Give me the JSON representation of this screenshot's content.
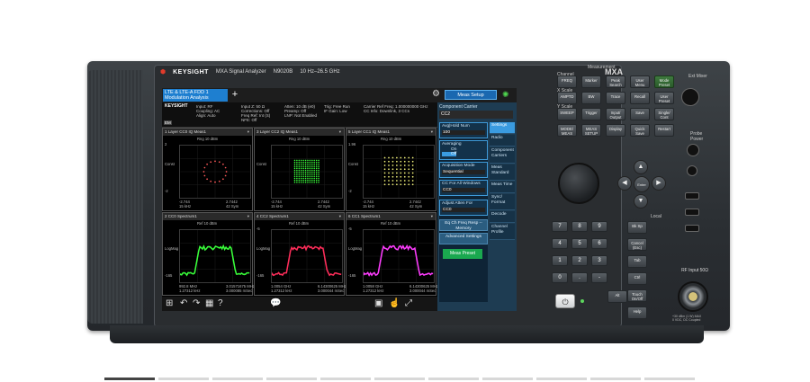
{
  "brand": {
    "logo_mark": "⬢",
    "name": "KEYSIGHT",
    "model": "MXA Signal Analyzer",
    "model_no": "N9020B",
    "range": "10 Hz–26.5 GHz",
    "badge": "MXA"
  },
  "screen": {
    "active_tab": "LTE & LTE-A FDD 1\nModulation Analysis",
    "add_tab": "+",
    "meas_setup": "Meas Setup",
    "info": {
      "keysight": "KEYSIGHT",
      "col1": "Input: RF\nCoupling: AC\nAlign: Auto",
      "col2": "Input Z: 50 Ω\nCorrections: Off\nFreq Ref: Int (S)\nNFE: Off",
      "col3": "Atten: 10 dB (e0)\nPreamp: Off\nLNP: Not Enabled",
      "col4": "Trig: Free Run\nIF Gain: Low",
      "col5": "Carrier Ref Freq: 1.000000000 GHz\nCC Info: Downlink, 3 CCs",
      "badge": "EM"
    },
    "windows": [
      {
        "title": "1 Layer CC0 IQ Meas1",
        "scale": "Rng 10 dBm",
        "ylabel": "Const",
        "ytop": "2",
        "ybot": "-2",
        "xleft": "-2.744\n15 kHz",
        "xright": "2.7442\n42 Sym",
        "kind": "const-ring"
      },
      {
        "title": "3 Layer CC2 IQ Meas1",
        "scale": "Rng 10 dBm",
        "ylabel": "Const",
        "ytop": "",
        "ybot": "",
        "xleft": "-2.744\n15 kHz",
        "xright": "2.7442\n42 Sym",
        "kind": "const-dense"
      },
      {
        "title": "5 Layer CC1 IQ Meas1",
        "scale": "Rng 10 dBm",
        "ylabel": "Const",
        "ytop": "1.96",
        "ybot": "-2",
        "xleft": "-2.744\n15 kHz",
        "xright": "2.7442\n42 Sym",
        "kind": "const-grid"
      },
      {
        "title": "2 CC0 Spectrum1",
        "scale": "Ref 10 dBm",
        "ylabel": "LogMag",
        "ytop": "",
        "ybot": "-165",
        "xleft": "992.8 MHz\n1.27312 kHz",
        "xright": "3.01571675 MHz\n3.000085 mSec",
        "kind": "spec-green"
      },
      {
        "title": "4 CC2 Spectrum1",
        "scale": "Ref 10 dBm",
        "ylabel": "LogMag",
        "ytop": "-5",
        "ybot": "-165",
        "xleft": "1.0054 GHz\n1.27312 kHz",
        "xright": "6.14300625 MHz\n3.000044 mSec",
        "kind": "spec-red"
      },
      {
        "title": "6 CC1 Spectrum1",
        "scale": "Ref 10 dBm",
        "ylabel": "LogMag",
        "ytop": "-5",
        "ybot": "-165",
        "xleft": "1.0058 GHz\n1.27312 kHz",
        "xright": "6.14300625 MHz\n3.000044 mSec",
        "kind": "spec-magenta"
      }
    ],
    "side": {
      "component_carrier_label": "Component Carrier",
      "component_carrier_value": "CC2",
      "avg_hold_label": "Avg|Hold Num",
      "avg_hold_value": "100",
      "averaging_label": "Averaging",
      "averaging_on": "On",
      "averaging_off": "Off",
      "acq_label": "Acquisition Mode",
      "acq_value": "Sequential",
      "cc_all_label": "CC For All Windows",
      "cc_all_value": "CC0",
      "adjust_label": "Adjust Atten For",
      "adjust_value": "CC0",
      "eq_btn": "Eq Ch Freq Resp --\nMemory",
      "adv_btn": "Advanced\nSettings",
      "meas_preset": "Meas Preset",
      "tabs": [
        "Settings",
        "Radio",
        "Component\nCarriers",
        "Meas\nStandard",
        "Meas Time",
        "Sync/\nFormat",
        "Decode",
        "Channel\nProfile"
      ]
    },
    "taskbar": [
      "⊞",
      "↶",
      "↷",
      "▦",
      "?",
      "💬",
      "▣",
      "☝",
      "⤢"
    ]
  },
  "panel": {
    "hdr_channel": "Channel",
    "hdr_measurement": "Measurement",
    "hdr_xscale": "X Scale",
    "hdr_yscale": "Y Scale",
    "hdr_local": "Local",
    "hdr_windows": "Windows",
    "keys": [
      "FREQ",
      "Marker",
      "Peak\nSearch",
      "User\nMenu",
      "Mode\nPreset",
      "AMPTD",
      "BW",
      "Trace",
      "Recall",
      "User\nPreset",
      "SWEEP",
      "Trigger",
      "Input/\nOutput",
      "Save",
      "Single/\nCont",
      "MODE/\nMEAS",
      "MEAS\nSETUP",
      "Display",
      "Quick\nSave",
      "Restart"
    ],
    "numpad": [
      "7",
      "8",
      "9",
      "4",
      "5",
      "6",
      "1",
      "2",
      "3",
      "0",
      ".",
      "-"
    ],
    "numpad_right": [
      "Bk Sp",
      "Cancel\n(Esc)",
      "Tab",
      "Ctrl",
      "Touch\nOn/Off",
      "Help"
    ],
    "numpad_right2": [
      "Alt",
      "Enter",
      "System",
      "Undo"
    ],
    "enter": "Enter",
    "ext_mixer": "Ext Mixer",
    "probe_power": "Probe\nPower",
    "rf_input": "RF Input 50Ω",
    "rf_warning": "+30 dBm (1 W) MAX\n0 VDC, DC Coupled"
  },
  "colors": {
    "accent": "#1e7fd0",
    "panel_bg": "#1e3c52",
    "trace_green": "#39ff3a",
    "trace_red": "#ff2d5a",
    "trace_magenta": "#ff3cff",
    "const_white": "#ffffff",
    "led_green": "#5dd65d"
  }
}
